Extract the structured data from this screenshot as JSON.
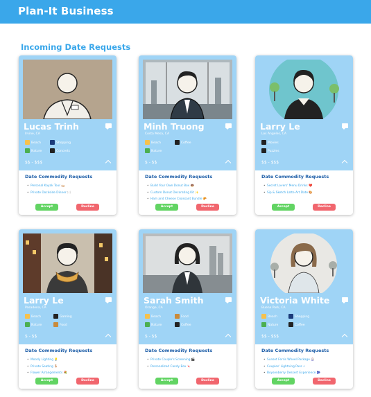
{
  "app": {
    "brand": "Plan-It Business"
  },
  "section_title": "Incoming Date Requests",
  "request_heading": "Date Commodity Requests",
  "buttons": {
    "accept": "Accept",
    "decline": "Decline"
  },
  "cards": [
    {
      "name": "Lucas Trinh",
      "location": "Irvine, CA",
      "price": "$$ - $$$",
      "interests": [
        {
          "label": "Beach",
          "icon": "beach-icon"
        },
        {
          "label": "Shopping",
          "icon": "cart-icon"
        },
        {
          "label": "Nature",
          "icon": "tree-icon"
        },
        {
          "label": "Concerts",
          "icon": "music-icon"
        }
      ],
      "requests": [
        "Personal Kayak Tour 🛶",
        "Private Dockside Dinner 🍽️"
      ]
    },
    {
      "name": "Minh Truong",
      "location": "Costa Mesa, CA",
      "price": "$ - $$",
      "interests": [
        {
          "label": "Beach",
          "icon": "beach-icon"
        },
        {
          "label": "Coffee",
          "icon": "coffee-icon"
        },
        {
          "label": "Nature",
          "icon": "tree-icon"
        }
      ],
      "requests": [
        "Build Your Own Donut Box 🍩",
        "Custom Donut Decorating Kit ✨",
        "Ham and Cheese Croissant Bundle 🥐"
      ]
    },
    {
      "name": "Larry Le",
      "location": "Los Angeles, CA",
      "price": "$$ - $$$",
      "interests": [
        {
          "label": "Movies",
          "icon": "film-icon"
        },
        {
          "label": "Puzzles",
          "icon": "puzzle-icon"
        }
      ],
      "requests": [
        "Secret Lovers' Menu Drinks ❤️",
        "Sip & Sketch Latte Art Date 🎨"
      ]
    },
    {
      "name": "Larry Le",
      "location": "Pasadena, CA",
      "price": "$ - $$",
      "interests": [
        {
          "label": "Beach",
          "icon": "beach-icon"
        },
        {
          "label": "Gaming",
          "icon": "gamepad-icon"
        },
        {
          "label": "Nature",
          "icon": "tree-icon"
        },
        {
          "label": "Food",
          "icon": "food-icon"
        }
      ],
      "requests": [
        "Moody Lighting 💡",
        "Private Seating 🪑",
        "Flower Arrangements 💐"
      ]
    },
    {
      "name": "Sarah Smith",
      "location": "Orange, CA",
      "price": "$ - $$",
      "interests": [
        {
          "label": "Beach",
          "icon": "beach-icon"
        },
        {
          "label": "Food",
          "icon": "food-icon"
        },
        {
          "label": "Nature",
          "icon": "tree-icon"
        },
        {
          "label": "Coffee",
          "icon": "coffee-icon"
        }
      ],
      "requests": [
        "Private Couple's Screening 🎬",
        "Personalized Candy Box 🍬"
      ]
    },
    {
      "name": "Victoria White",
      "location": "Buena Park, CA",
      "price": "$$ - $$$",
      "interests": [
        {
          "label": "Beach",
          "icon": "beach-icon"
        },
        {
          "label": "Shopping",
          "icon": "cart-icon"
        },
        {
          "label": "Nature",
          "icon": "tree-icon"
        },
        {
          "label": "Coffee",
          "icon": "coffee-icon"
        }
      ],
      "requests": [
        "Sunset Ferris Wheel Package 🎡",
        "Couples' Lightning Pass ⚡",
        "Boysenberry Dessert Experience 🫐"
      ]
    }
  ],
  "colors": {
    "header": "#3aa7ea",
    "card_top": "#9fd4f6",
    "accept": "#62d463",
    "decline": "#f1666e",
    "heading": "#1f5fa8"
  }
}
